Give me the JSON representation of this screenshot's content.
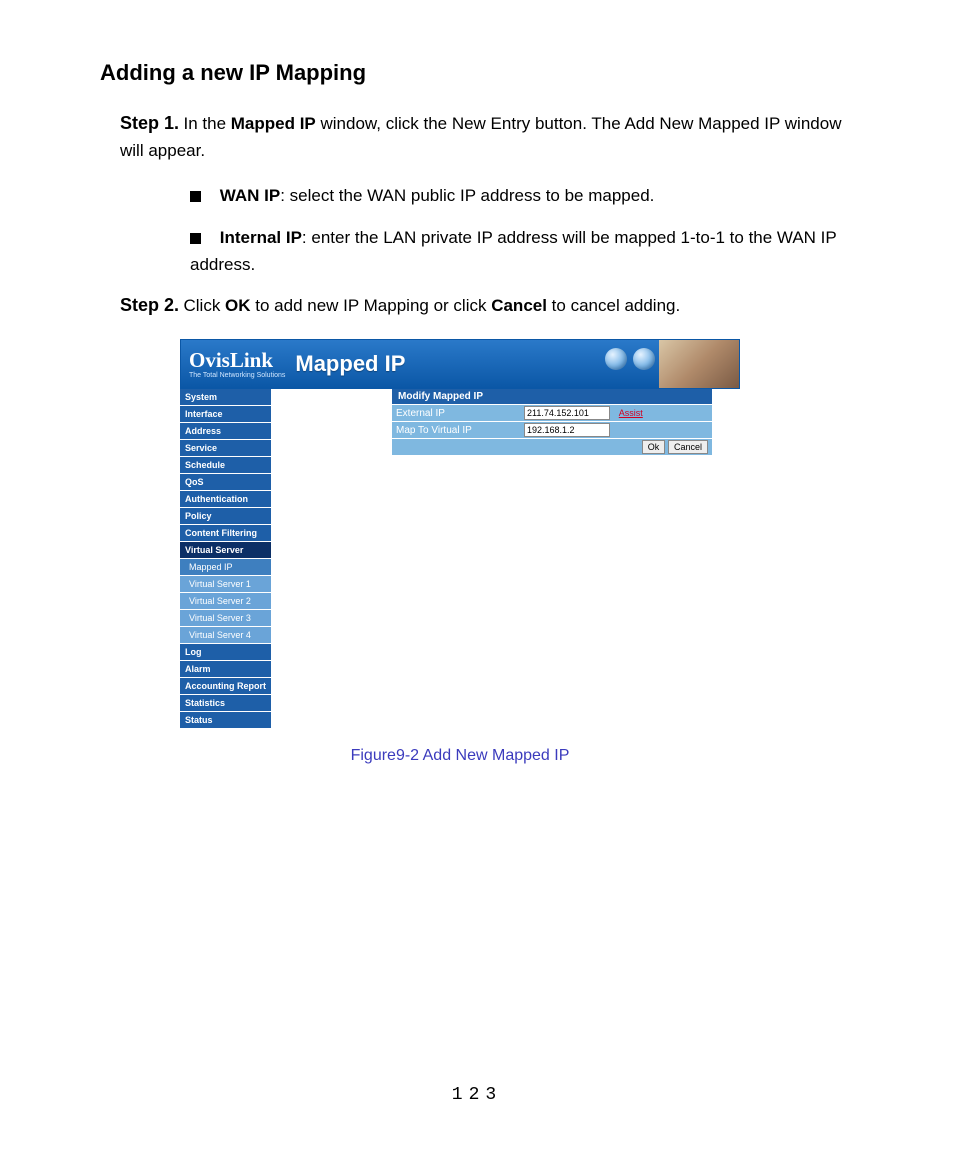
{
  "heading": "Adding a new IP Mapping",
  "step1": {
    "label": "Step 1.",
    "text_before_bold1": " In the ",
    "bold1": "Mapped IP",
    "text_after_bold1": " window, click the New Entry button. The Add New Mapped IP window will appear."
  },
  "bullet1": {
    "bold": "WAN IP",
    "text": ": select the WAN public IP address to be mapped."
  },
  "bullet2": {
    "bold": "Internal IP",
    "text": ": enter the LAN private IP address will be mapped 1-to-1 to the WAN IP address."
  },
  "step2": {
    "label": "Step 2.",
    "text_before_ok": " Click ",
    "ok": "OK",
    "text_mid": " to add new IP Mapping or click ",
    "cancel": "Cancel",
    "text_after": " to cancel adding."
  },
  "app": {
    "brand": "OvisLink",
    "tagline": "The Total Networking Solutions",
    "title": "Mapped IP",
    "sidebar": {
      "items": [
        "System",
        "Interface",
        "Address",
        "Service",
        "Schedule",
        "QoS",
        "Authentication",
        "Policy",
        "Content Filtering",
        "Virtual Server"
      ],
      "sub_items": [
        "Mapped IP",
        "Virtual Server 1",
        "Virtual Server 2",
        "Virtual Server 3",
        "Virtual Server 4"
      ],
      "tail_items": [
        "Log",
        "Alarm",
        "Accounting Report",
        "Statistics",
        "Status"
      ]
    },
    "form": {
      "header": "Modify Mapped IP",
      "row1_label": "External IP",
      "row1_value": "211.74.152.101",
      "assist": "Assist",
      "row2_label": "Map To Virtual IP",
      "row2_value": "192.168.1.2",
      "ok_btn": "Ok",
      "cancel_btn": "Cancel"
    }
  },
  "caption": "Figure9-2    Add New Mapped IP",
  "page_number": "123"
}
